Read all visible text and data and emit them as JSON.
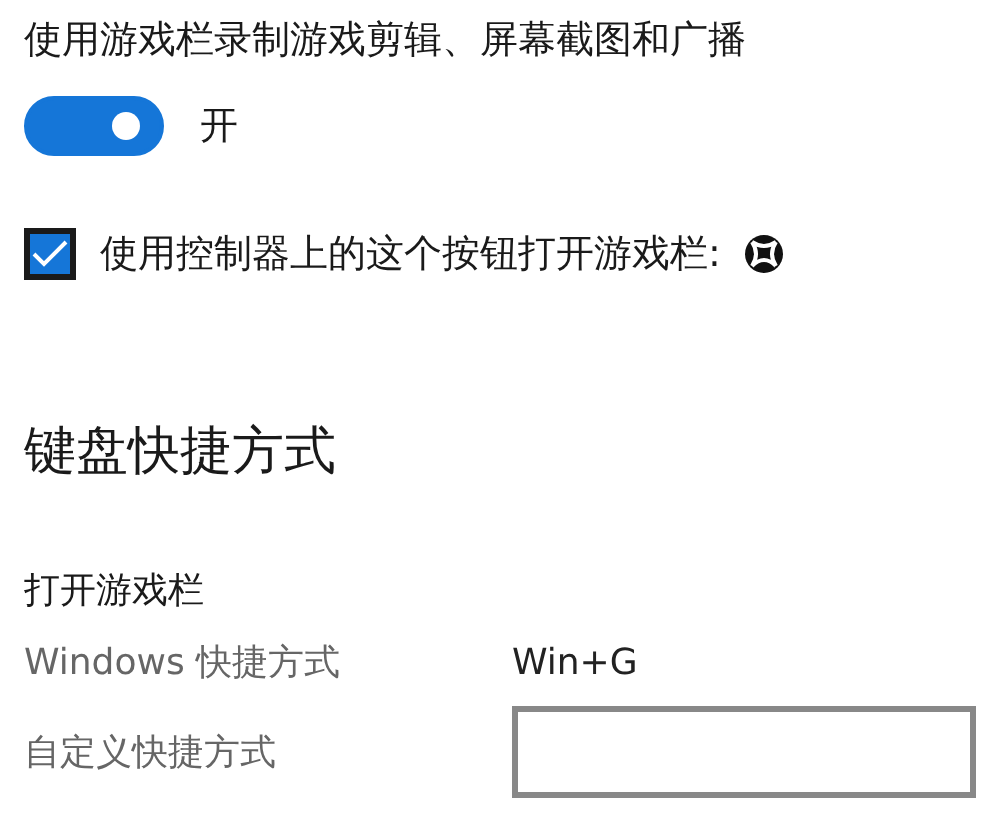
{
  "game_bar": {
    "label": "使用游戏栏录制游戏剪辑、屏幕截图和广播",
    "toggle": {
      "on": true,
      "state_text": "开"
    }
  },
  "controller_button": {
    "label": "使用控制器上的这个按钮打开游戏栏:",
    "checked": true
  },
  "keyboard_shortcuts": {
    "heading": "键盘快捷方式",
    "section": "打开游戏栏",
    "rows": [
      {
        "label": "Windows 快捷方式",
        "kind": "text",
        "value": "Win+G"
      },
      {
        "label": "自定义快捷方式",
        "kind": "field"
      }
    ]
  }
}
